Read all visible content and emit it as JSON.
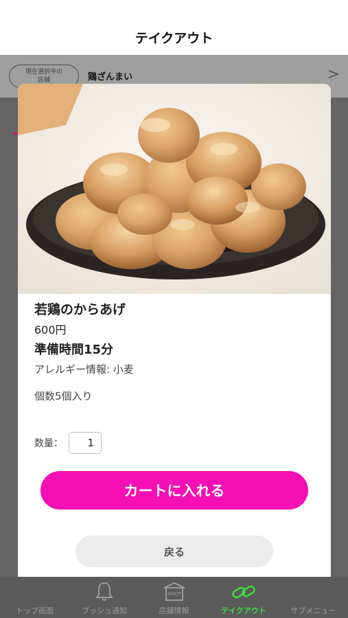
{
  "header": {
    "title": "テイクアウト"
  },
  "store": {
    "badge_line1": "現在選択中の",
    "badge_line2": "店舗",
    "name": "鶏ざんまい",
    "chevron": ">"
  },
  "modal": {
    "item_name": "若鶏のからあげ",
    "price": "600円",
    "prep_time": "準備時間15分",
    "allergy": "アレルギー情報: 小麦",
    "pieces": "個数5個入り",
    "quantity_label": "数量：",
    "quantity_value": "1",
    "add_to_cart": "カートに入れる",
    "back": "戻る",
    "accent_color": "#f50fb4"
  },
  "tabbar": {
    "items": [
      {
        "label": "トップ画面",
        "icon": "home-icon"
      },
      {
        "label": "プッシュ通知",
        "icon": "bell-icon"
      },
      {
        "label": "店舗情報",
        "icon": "shop-icon",
        "icon_text": "SHOP"
      },
      {
        "label": "テイクアウト",
        "icon": "link-icon",
        "active": true
      },
      {
        "label": "サブメニュー",
        "icon": "menu-icon"
      }
    ],
    "active_color": "#3fdc3f"
  }
}
